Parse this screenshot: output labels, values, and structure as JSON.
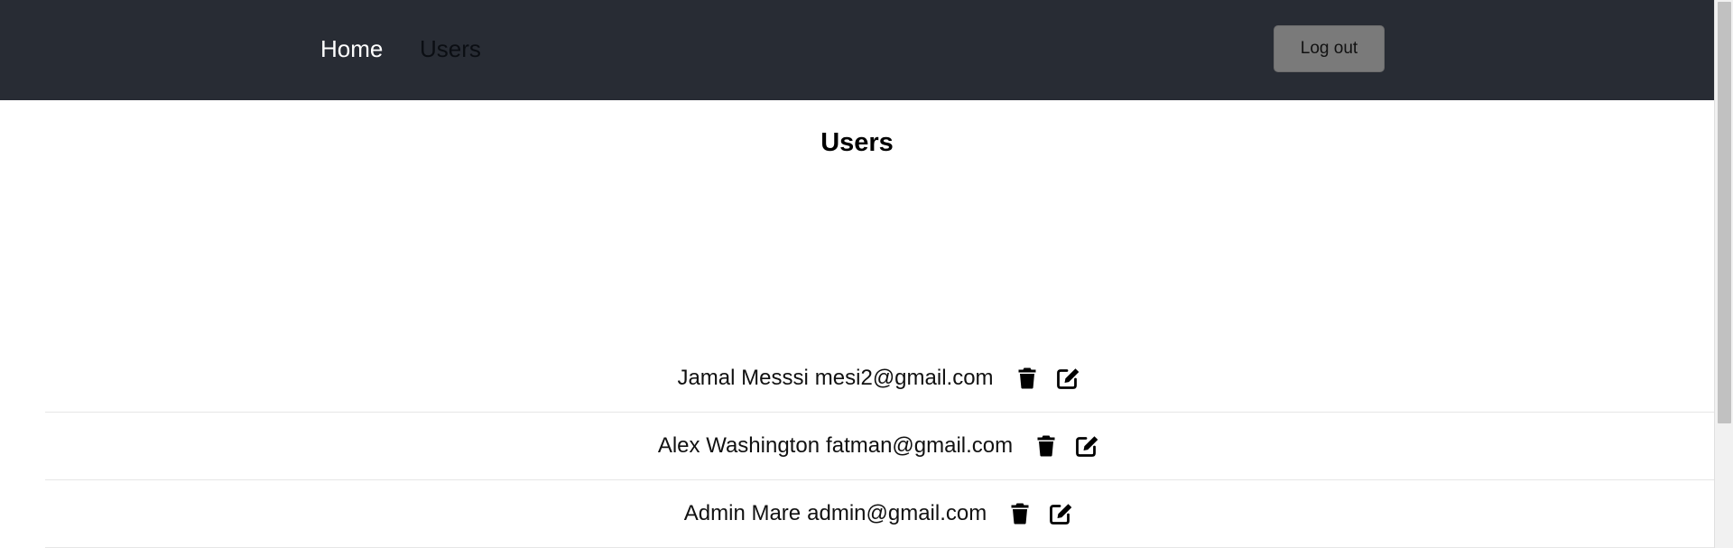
{
  "navbar": {
    "home_label": "Home",
    "users_label": "Users",
    "logout_label": "Log out"
  },
  "page": {
    "title": "Users"
  },
  "users": [
    {
      "name": "Jamal Messsi",
      "email": "mesi2@gmail.com"
    },
    {
      "name": "Alex Washington",
      "email": "fatman@gmail.com"
    },
    {
      "name": "Admin Mare",
      "email": "admin@gmail.com"
    }
  ],
  "icons": {
    "delete": "trash-icon",
    "edit": "edit-icon"
  },
  "colors": {
    "navbar_bg": "#282c34",
    "logout_bg": "#7a7a7a"
  }
}
